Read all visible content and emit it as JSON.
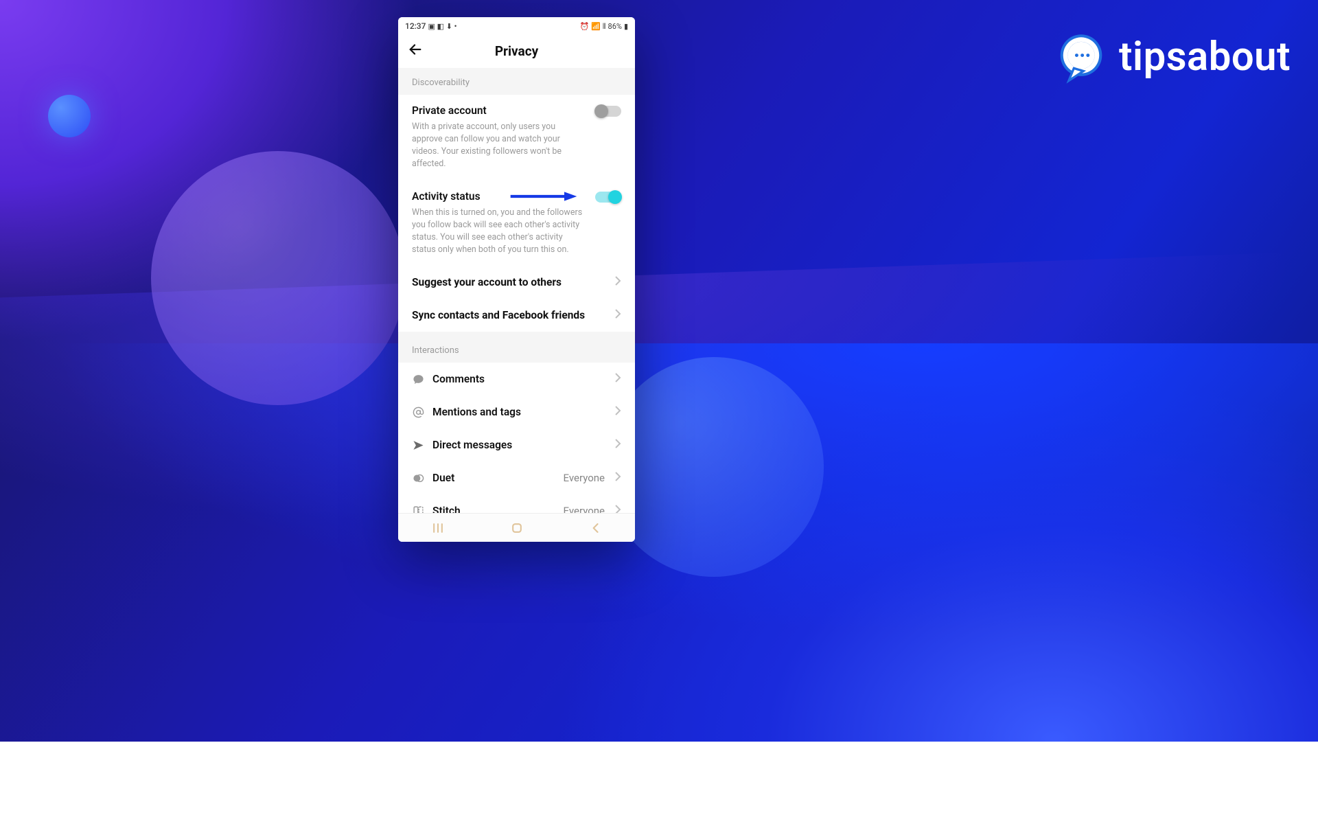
{
  "brand": {
    "name": "tipsabout"
  },
  "statusbar": {
    "time": "12:37",
    "battery": "86%"
  },
  "titlebar": {
    "title": "Privacy"
  },
  "sections": {
    "discoverability": "Discoverability",
    "interactions": "Interactions"
  },
  "private_account": {
    "title": "Private account",
    "desc": "With a private account, only users you approve can follow you and watch your videos. Your existing followers won't be affected."
  },
  "activity_status": {
    "title": "Activity status",
    "desc": "When this is turned on, you and the followers you follow back will see each other's activity status. You will see each other's activity status only when both of you turn this on."
  },
  "suggest": {
    "title": "Suggest your account to others"
  },
  "sync": {
    "title": "Sync contacts and Facebook friends"
  },
  "interactions": {
    "comments": {
      "label": "Comments"
    },
    "mentions": {
      "label": "Mentions and tags"
    },
    "dm": {
      "label": "Direct messages"
    },
    "duet": {
      "label": "Duet",
      "value": "Everyone"
    },
    "stitch": {
      "label": "Stitch",
      "value": "Everyone"
    }
  }
}
